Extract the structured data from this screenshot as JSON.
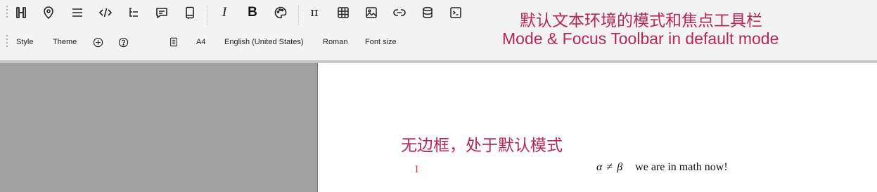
{
  "toolbar": {
    "row1_icons": [
      "heading-icon",
      "location-pin-icon",
      "list-icon",
      "code-icon",
      "outline-icon",
      "comment-icon",
      "notebook-icon",
      "italic-icon",
      "bold-icon",
      "palette-icon",
      "pi-icon",
      "table-icon",
      "image-icon",
      "link-icon",
      "database-icon",
      "terminal-icon"
    ],
    "italic_label": "I",
    "bold_label": "B",
    "pi_label": "π",
    "style_label": "Style",
    "theme_label": "Theme",
    "page_size_label": "A4",
    "language_label": "English (United States)",
    "font_label": "Roman",
    "font_size_label": "Font size"
  },
  "annotations": {
    "title_zh": "默认文本环境的模式和焦点工具栏",
    "title_en": "Mode & Focus Toolbar in default mode",
    "body_zh": "无边框，处于默认模式"
  },
  "document": {
    "cursor": "I",
    "math_alpha": "α",
    "math_neq": "≠",
    "math_beta": "β",
    "text": "we are in math now!"
  },
  "colors": {
    "annotation": "#b5265b",
    "cursor": "#e03030",
    "gutter": "#a0a0a0",
    "toolbar_bg": "#f3f3f3"
  }
}
